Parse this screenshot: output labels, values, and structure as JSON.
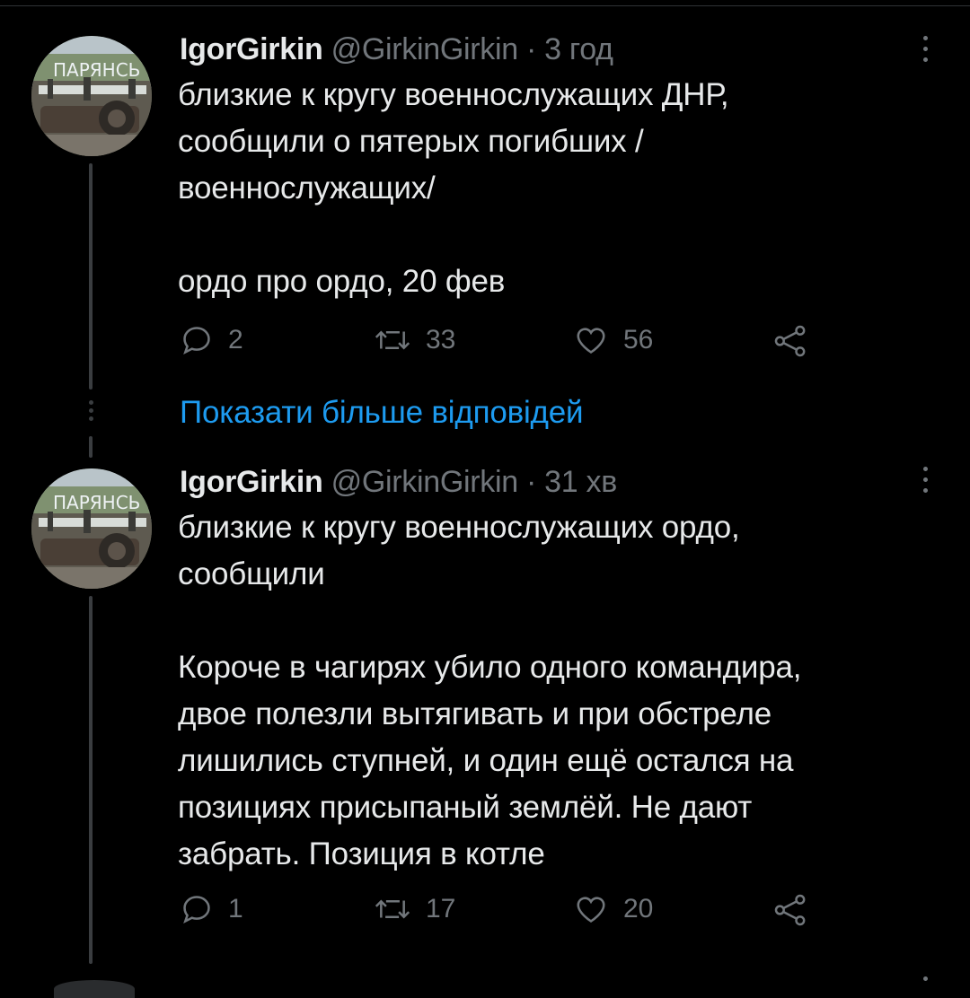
{
  "tweets": [
    {
      "author_name": "IgorGirkin",
      "handle_time": "@GirkinGirkin · 3 год",
      "text": "близкие к кругу военнослужащих ДНР,\nсообщили о пятерых погибших /\nвоеннослужащих/\n\nордо про ордо, 20 фев",
      "avatar_text": "ПАРЯНСЬ",
      "replies": "2",
      "retweets": "33",
      "likes": "56"
    },
    {
      "author_name": "IgorGirkin",
      "handle_time": "@GirkinGirkin · 31 хв",
      "text": "близкие к кругу военнослужащих ордо,\nсообщили\n\nКороче в чагирях убило одного командира,\nдвое полезли вытягивать и при обстреле\nлишились ступней, и один ещё остался на\nпозициях присыпаный землёй. Не дают\nзабрать. Позиция в котле",
      "avatar_text": "ПАРЯНСЬ",
      "replies": "1",
      "retweets": "17",
      "likes": "20"
    }
  ],
  "show_more_replies": "Показати більше відповідей",
  "colors": {
    "background": "#000000",
    "text": "#e7e9ea",
    "secondary": "#71767b",
    "link": "#1d9bf0",
    "thread_line": "#3a3d40"
  },
  "icons": [
    "reply-icon",
    "retweet-icon",
    "like-icon",
    "share-icon",
    "more-icon"
  ]
}
